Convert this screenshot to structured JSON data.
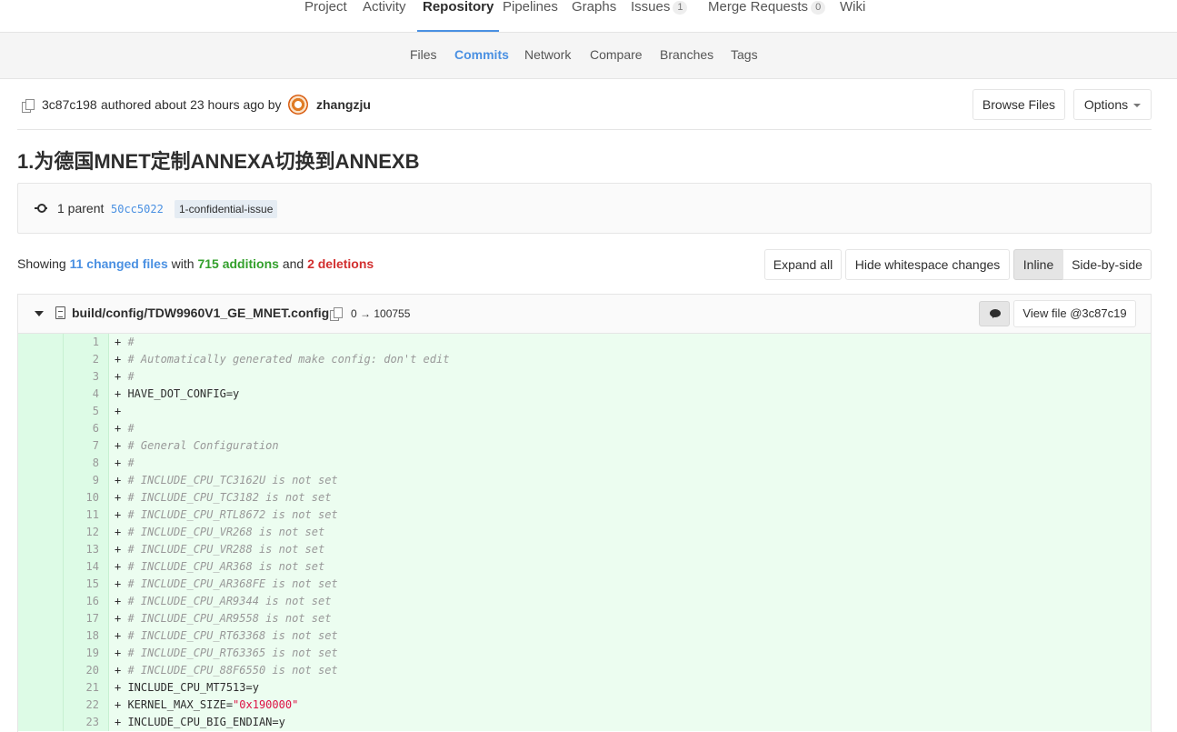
{
  "top_nav": {
    "tabs": [
      {
        "label": "Project"
      },
      {
        "label": "Activity"
      },
      {
        "label": "Repository",
        "active": true
      },
      {
        "label": "Pipelines"
      },
      {
        "label": "Graphs"
      },
      {
        "label": "Issues",
        "count": "1"
      },
      {
        "label": "Merge Requests",
        "count": "0"
      },
      {
        "label": "Wiki"
      }
    ]
  },
  "sub_nav": {
    "tabs": [
      {
        "label": "Files"
      },
      {
        "label": "Commits",
        "active": true
      },
      {
        "label": "Network"
      },
      {
        "label": "Compare"
      },
      {
        "label": "Branches"
      },
      {
        "label": "Tags"
      }
    ]
  },
  "commit": {
    "sha": "3c87c198",
    "authored_text": "authored about 23 hours ago by",
    "author": "zhangzju",
    "browse_files_label": "Browse Files",
    "options_label": "Options",
    "title": "1.为德国MNET定制ANNEXA切换到ANNEXB",
    "parent_label": "1 parent",
    "parent_sha": "50cc5022",
    "branch": "1-confidential-issue"
  },
  "stats": {
    "showing": "Showing",
    "changed_files": "11 changed files",
    "with": "with",
    "additions": "715 additions",
    "and": "and",
    "deletions": "2 deletions"
  },
  "toolbar": {
    "expand_all": "Expand all",
    "hide_whitespace": "Hide whitespace changes",
    "inline": "Inline",
    "side_by_side": "Side-by-side"
  },
  "file": {
    "path": "build/config/TDW9960V1_GE_MNET.config",
    "mode_change": "0 → 100755",
    "view_file": "View file @3c87c19"
  },
  "diff_lines": [
    {
      "n": "1",
      "text": "#",
      "kind": "comment"
    },
    {
      "n": "2",
      "text": "# Automatically generated make config: don't edit",
      "kind": "comment"
    },
    {
      "n": "3",
      "text": "#",
      "kind": "comment"
    },
    {
      "n": "4",
      "text": "HAVE_DOT_CONFIG=y",
      "kind": "plain"
    },
    {
      "n": "5",
      "text": "",
      "kind": "plain"
    },
    {
      "n": "6",
      "text": "#",
      "kind": "comment"
    },
    {
      "n": "7",
      "text": "# General Configuration",
      "kind": "comment"
    },
    {
      "n": "8",
      "text": "#",
      "kind": "comment"
    },
    {
      "n": "9",
      "text": "# INCLUDE_CPU_TC3162U is not set",
      "kind": "comment"
    },
    {
      "n": "10",
      "text": "# INCLUDE_CPU_TC3182 is not set",
      "kind": "comment"
    },
    {
      "n": "11",
      "text": "# INCLUDE_CPU_RTL8672 is not set",
      "kind": "comment"
    },
    {
      "n": "12",
      "text": "# INCLUDE_CPU_VR268 is not set",
      "kind": "comment"
    },
    {
      "n": "13",
      "text": "# INCLUDE_CPU_VR288 is not set",
      "kind": "comment"
    },
    {
      "n": "14",
      "text": "# INCLUDE_CPU_AR368 is not set",
      "kind": "comment"
    },
    {
      "n": "15",
      "text": "# INCLUDE_CPU_AR368FE is not set",
      "kind": "comment"
    },
    {
      "n": "16",
      "text": "# INCLUDE_CPU_AR9344 is not set",
      "kind": "comment"
    },
    {
      "n": "17",
      "text": "# INCLUDE_CPU_AR9558 is not set",
      "kind": "comment"
    },
    {
      "n": "18",
      "text": "# INCLUDE_CPU_RT63368 is not set",
      "kind": "comment"
    },
    {
      "n": "19",
      "text": "# INCLUDE_CPU_RT63365 is not set",
      "kind": "comment"
    },
    {
      "n": "20",
      "text": "# INCLUDE_CPU_88F6550 is not set",
      "kind": "comment"
    },
    {
      "n": "21",
      "text": "INCLUDE_CPU_MT7513=y",
      "kind": "plain"
    },
    {
      "n": "22",
      "key": "KERNEL_MAX_SIZE=",
      "value": "\"0x190000\"",
      "kind": "string"
    },
    {
      "n": "23",
      "text": "INCLUDE_CPU_BIG_ENDIAN=y",
      "kind": "plain"
    }
  ]
}
